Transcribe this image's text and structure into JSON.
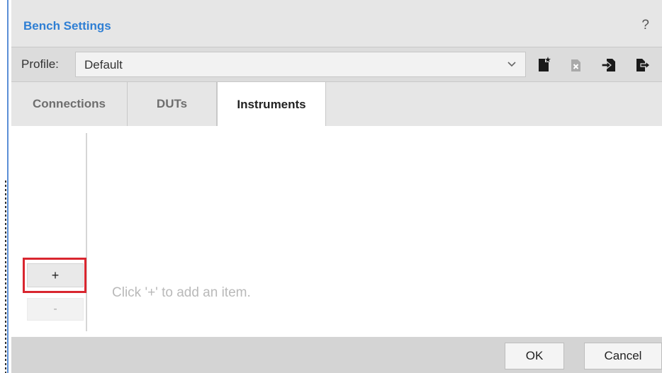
{
  "window": {
    "title": "Bench Settings",
    "help_label": "?"
  },
  "profile": {
    "label": "Profile:",
    "selected": "Default",
    "toolbar_icons": [
      "new-profile-icon",
      "delete-profile-icon",
      "import-profile-icon",
      "export-profile-icon"
    ]
  },
  "tabs": [
    {
      "label": "Connections",
      "active": false
    },
    {
      "label": "DUTs",
      "active": false
    },
    {
      "label": "Instruments",
      "active": true
    }
  ],
  "list": {
    "add_label": "+",
    "remove_label": "-",
    "empty_hint": "Click '+' to add an item."
  },
  "footer": {
    "ok_label": "OK",
    "cancel_label": "Cancel"
  },
  "colors": {
    "title_blue": "#2f7fd4",
    "highlight_red": "#d9262f",
    "window_border": "#5b8fd6"
  }
}
